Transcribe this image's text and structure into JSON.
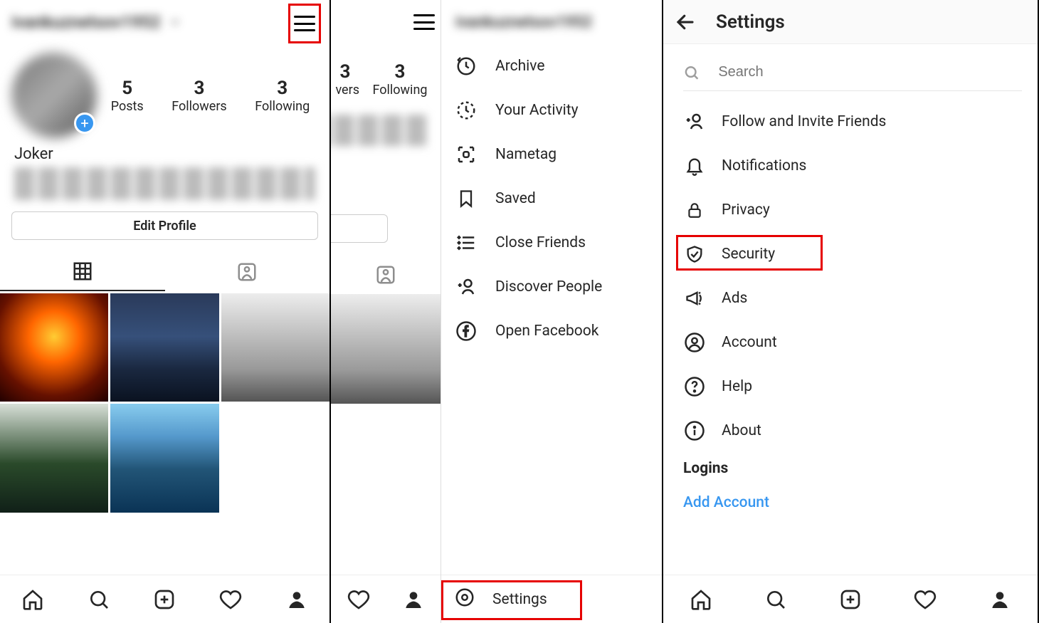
{
  "panel1": {
    "username": "ivankuznetsov1952",
    "stats": [
      {
        "num": "5",
        "label": "Posts"
      },
      {
        "num": "3",
        "label": "Followers"
      },
      {
        "num": "3",
        "label": "Following"
      }
    ],
    "display_name": "Joker",
    "edit_profile_label": "Edit Profile"
  },
  "panel2_left": {
    "stats_partial": [
      {
        "num": "3",
        "label": "vers"
      },
      {
        "num": "3",
        "label": "Following"
      }
    ]
  },
  "panel2_right": {
    "username": "ivankuznetsov1952",
    "menu": [
      {
        "icon": "archive",
        "label": "Archive"
      },
      {
        "icon": "activity",
        "label": "Your Activity"
      },
      {
        "icon": "nametag",
        "label": "Nametag"
      },
      {
        "icon": "saved",
        "label": "Saved"
      },
      {
        "icon": "close-friends",
        "label": "Close Friends"
      },
      {
        "icon": "discover",
        "label": "Discover People"
      },
      {
        "icon": "facebook",
        "label": "Open Facebook"
      }
    ],
    "settings_label": "Settings"
  },
  "panel3": {
    "header_title": "Settings",
    "search_placeholder": "Search",
    "items": [
      {
        "icon": "follow-invite",
        "label": "Follow and Invite Friends"
      },
      {
        "icon": "notifications",
        "label": "Notifications"
      },
      {
        "icon": "privacy",
        "label": "Privacy"
      },
      {
        "icon": "security",
        "label": "Security",
        "highlight": true
      },
      {
        "icon": "ads",
        "label": "Ads"
      },
      {
        "icon": "account",
        "label": "Account"
      },
      {
        "icon": "help",
        "label": "Help"
      },
      {
        "icon": "about",
        "label": "About"
      }
    ],
    "logins_header": "Logins",
    "add_account_label": "Add Account"
  }
}
